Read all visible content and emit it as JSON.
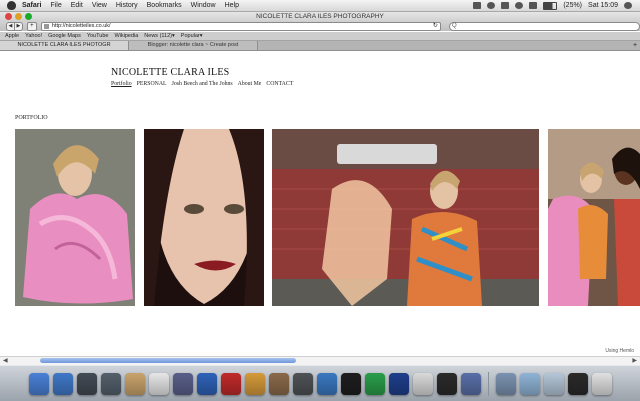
{
  "menubar": {
    "app": "Safari",
    "items": [
      "File",
      "Edit",
      "View",
      "History",
      "Bookmarks",
      "Window",
      "Help"
    ],
    "battery": "(25%)",
    "clock": "Sat 15:09"
  },
  "window": {
    "title": "NICOLETTE CLARA ILES PHOTOGRAPHY"
  },
  "toolbar": {
    "url": "http://nicoletteiles.co.uk/",
    "back_label": "◀",
    "forward_label": "▶",
    "add_label": "+",
    "reload_label": "↻",
    "search_label": "Q"
  },
  "bookmarks": [
    "Apple",
    "Yahoo!",
    "Google Maps",
    "YouTube",
    "Wikipedia",
    "News (112)▾",
    "Popular▾"
  ],
  "tabs": [
    {
      "label": "NICOLETTE CLARA ILES PHOTOGR"
    },
    {
      "label": "Blogger: nicolette clara ~ Create post"
    }
  ],
  "tab_add_label": "+",
  "site": {
    "title": "NICOLETTE CLARA ILES",
    "nav": [
      "Portfolio",
      "PERSONAL",
      "Josh Beech and The Johns",
      "About Me",
      "CONTACT"
    ],
    "section": "PORTFOLIO"
  },
  "credit": "Using  Hemlo",
  "dock": {
    "colors": [
      "#4a80d6",
      "#3f78c8",
      "#444b55",
      "#54606c",
      "#c9a36b",
      "#e6e6e6",
      "#5a5f8a",
      "#2e62b8",
      "#c02a2a",
      "#d49a3a",
      "#8a6a4a",
      "#4f5256",
      "#3a78c0",
      "#1e1e1e",
      "#2a9d4a",
      "#1f3f8c",
      "#d9d9d9",
      "#2b2b2b",
      "#5a6fa8",
      "#7a92b0",
      "#8fb3d6",
      "#b4c6d8",
      "#2a2a2a",
      "#e0e0e0",
      "#9ca3aa"
    ]
  }
}
